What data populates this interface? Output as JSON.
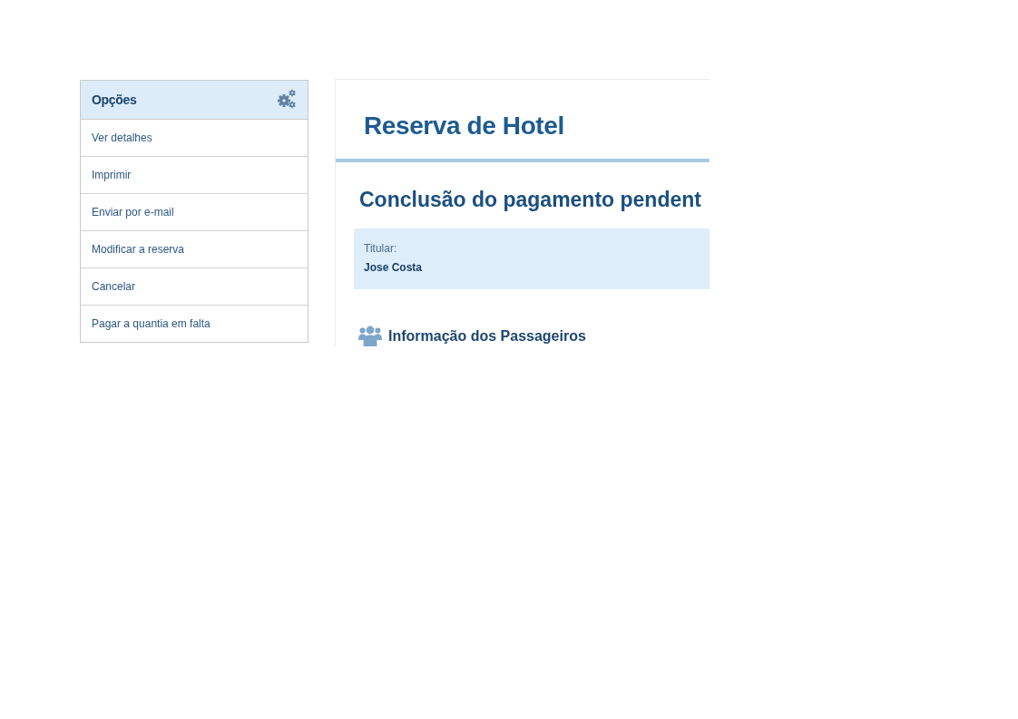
{
  "sidebar": {
    "title": "Opções",
    "items": [
      "Ver detalhes",
      "Imprimir",
      "Enviar por e-mail",
      "Modificar a reserva",
      "Cancelar",
      "Pagar a quantia em falta"
    ]
  },
  "main": {
    "title": "Reserva de Hotel",
    "status_heading": "Conclusão do pagamento pendent",
    "holder": {
      "label": "Titular:",
      "name": "Jose Costa"
    },
    "section": {
      "title": "Informação dos Passageiros"
    }
  }
}
